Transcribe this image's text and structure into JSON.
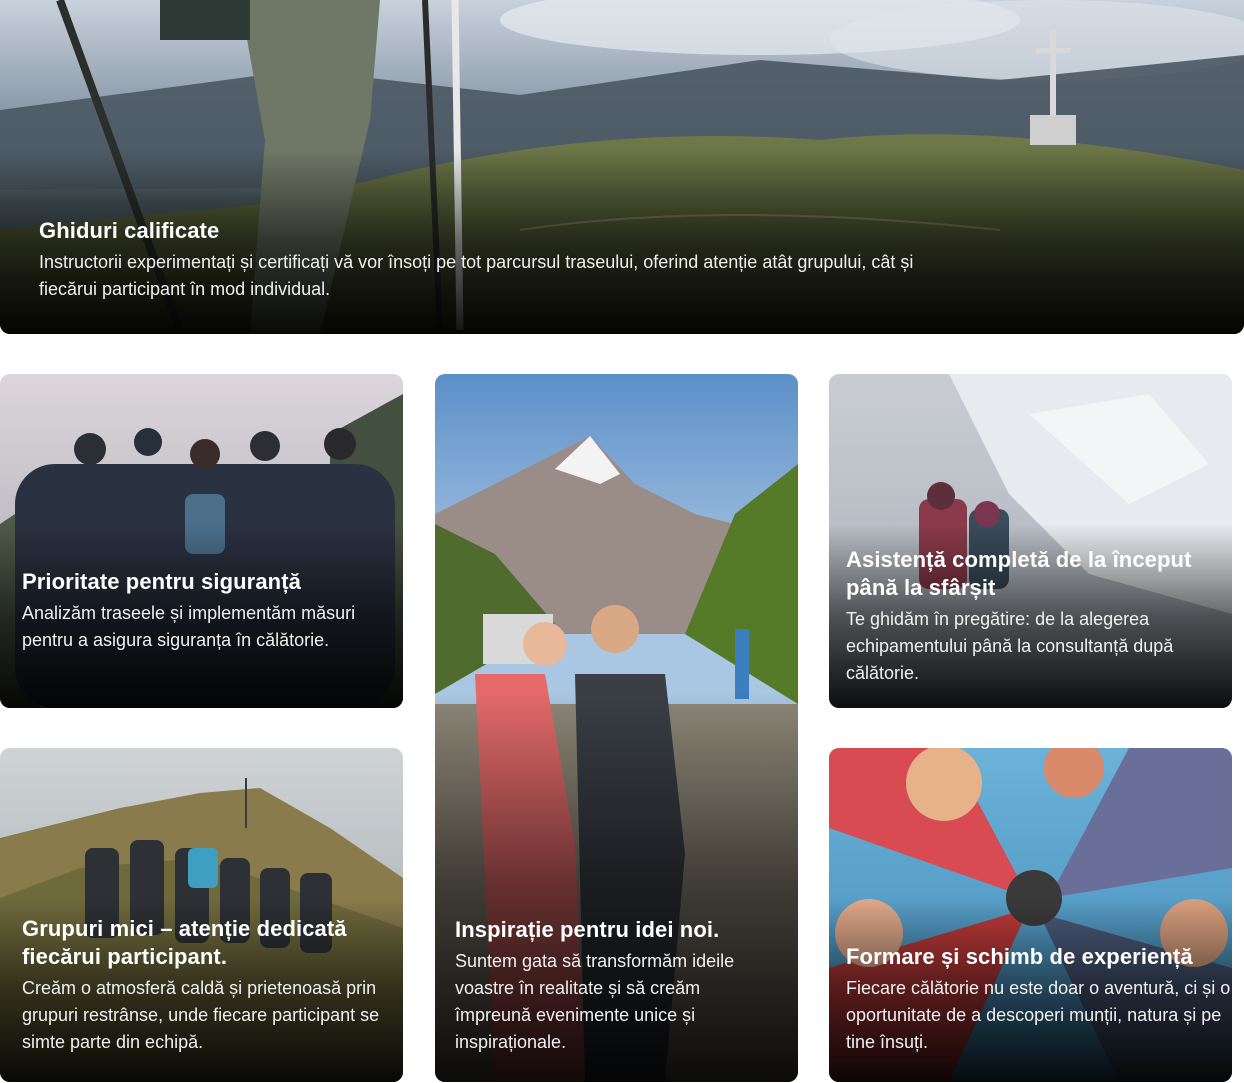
{
  "cards": {
    "hero": {
      "title": "Ghiduri calificate",
      "description": "Instructorii experimentați și certificați vă vor însoți pe tot parcursul traseului, oferind atenție atât grupului, cât și fiecărui participant în mod individual."
    },
    "safety": {
      "title": "Prioritate pentru siguranță",
      "description": "Analizăm traseele și implementăm măsuri pentru a asigura siguranța în călătorie."
    },
    "inspiration": {
      "title": "Inspirație pentru idei noi.",
      "description": "Suntem gata să transformăm ideile voastre în realitate și să creăm împreună evenimente unice și inspiraționale."
    },
    "assistance": {
      "title": "Asistență completă de la început până la sfârșit",
      "description": "Te ghidăm în pregătire: de la alegerea echipamentului până la consultanță după călătorie."
    },
    "small_groups": {
      "title": "Grupuri mici – atenție dedicată fiecărui participant.",
      "description": "Creăm o atmosferă caldă și prietenoasă prin grupuri restrânse, unde fiecare participant se simte parte din echipă."
    },
    "training": {
      "title": "Formare și schimb de experiență",
      "description": "Fiecare călătorie nu este doar o aventură, ci și o oportunitate de a descoperi munții, natura și pe tine însuți."
    }
  }
}
